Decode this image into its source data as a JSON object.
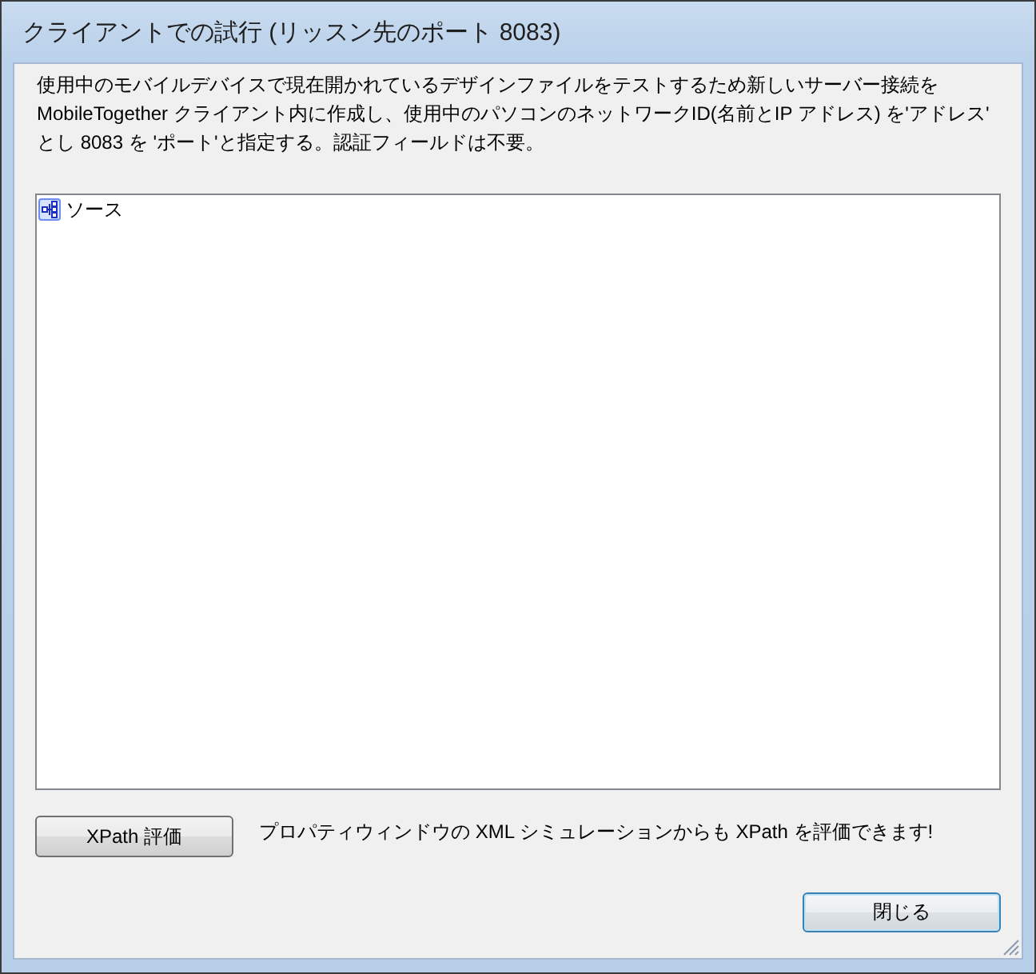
{
  "window": {
    "title": "クライアントでの試行 (リッスン先のポート 8083)"
  },
  "description": "使用中のモバイルデバイスで現在開かれているデザインファイルをテストするため新しいサーバー接続を\nMobileTogether クライアント内に作成し、使用中のパソコンのネットワークID(名前とIP アドレス) を'アドレス'\nとし 8083 を 'ポート'と指定する。認証フィールドは不要。",
  "tree": {
    "items": [
      {
        "label": "ソース"
      }
    ]
  },
  "xpath_button": {
    "label": "XPath 評価"
  },
  "hint": "プロパティウィンドウの XML シミュレーションからも XPath を評価できます!",
  "close_button": {
    "label": "閉じる",
    "focused": true
  }
}
